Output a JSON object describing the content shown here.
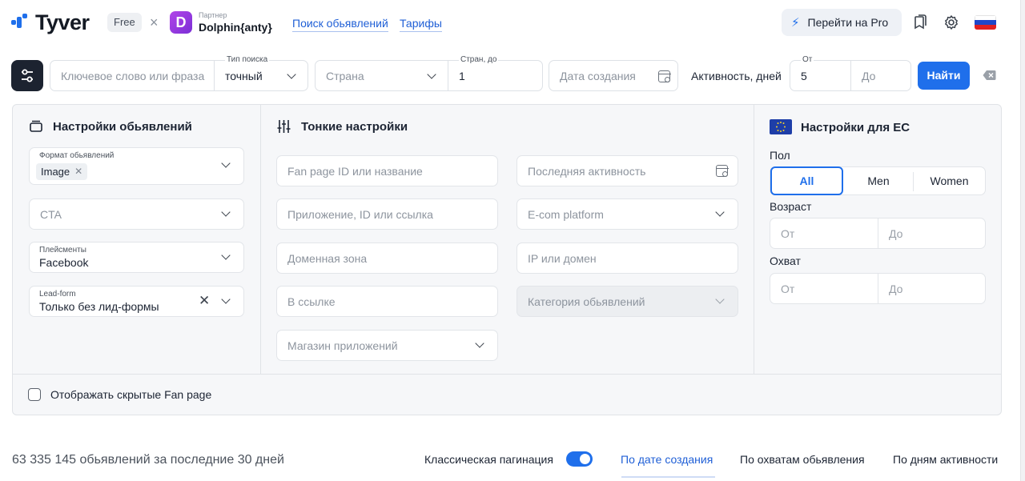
{
  "header": {
    "brand": "Tyver",
    "plan_badge": "Free",
    "separator": "×",
    "partner_caption": "Партнер",
    "partner_name": "Dolphin{anty}",
    "partner_logo_letter": "D",
    "nav": [
      {
        "label": "Поиск обьявлений"
      },
      {
        "label": "Тарифы"
      }
    ],
    "pro_button": "Перейти на Pro",
    "language": "ru"
  },
  "search": {
    "keyword_placeholder": "Ключевое слово или фраза",
    "search_type_label": "Тип поиска",
    "search_type_value": "точный",
    "country_placeholder": "Страна",
    "countries_up_to_label": "Стран, до",
    "countries_up_to_value": "1",
    "created_date_placeholder": "Дата создания",
    "activity_label": "Активность, дней",
    "activity_from_label": "От",
    "activity_from_value": "5",
    "activity_to_placeholder": "До",
    "find_button": "Найти"
  },
  "ad_settings": {
    "title": "Настройки обьявлений",
    "format_label": "Формат обьявлений",
    "format_chip": "Image",
    "cta_placeholder": "CTA",
    "placements_label": "Плейсменты",
    "placements_value": "Facebook",
    "leadform_label": "Lead-form",
    "leadform_value": "Только без лид-формы"
  },
  "fine_settings": {
    "title": "Тонкие настройки",
    "fan_page_placeholder": "Fan page ID или название",
    "app_placeholder": "Приложение, ID или ссылка",
    "domain_zone_placeholder": "Доменная зона",
    "in_link_placeholder": "В ссылке",
    "app_store_placeholder": "Магазин приложений",
    "last_activity_placeholder": "Последняя активность",
    "ecom_placeholder": "E-com platform",
    "ip_domain_placeholder": "IP или домен",
    "category_placeholder": "Категория обьявлений"
  },
  "eu_settings": {
    "title": "Настройки для ЕС",
    "gender_label": "Пол",
    "gender_options": [
      "All",
      "Men",
      "Women"
    ],
    "gender_selected": "All",
    "age_label": "Возраст",
    "age_from_placeholder": "От",
    "age_to_placeholder": "До",
    "reach_label": "Охват",
    "reach_from_placeholder": "От",
    "reach_to_placeholder": "До"
  },
  "show_hidden_fanpages": {
    "label": "Отображать скрытые Fan page",
    "checked": false
  },
  "footer": {
    "count_text": "63 335 145 обьявлений за последние 30 дней",
    "pagination_label": "Классическая пагинация",
    "pagination_on": true,
    "sort_tabs": [
      {
        "label": "По дате создания",
        "active": true
      },
      {
        "label": "По охватам обьявления",
        "active": false
      },
      {
        "label": "По дням активности",
        "active": false
      }
    ]
  },
  "colors": {
    "accent": "#1f6feb",
    "dark_button": "#1c2330",
    "panel_bg": "#f6f7f9",
    "partner_purple": "#9b3de0"
  }
}
